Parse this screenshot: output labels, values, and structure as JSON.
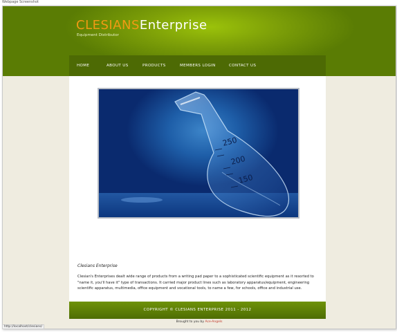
{
  "window": {
    "title": "Webpage Screenshot"
  },
  "brand": {
    "part1": "CLESIANS",
    "part2": "Enterprise",
    "tagline": "Equipment Distributor"
  },
  "nav": {
    "items": [
      "HOME",
      "ABOUT US",
      "PRODUCTS",
      "MEMBERS LOGIN",
      "CONTACT US"
    ]
  },
  "hero": {
    "marks": [
      "250",
      "200",
      "150"
    ]
  },
  "content": {
    "title": "Clesians Enterprise",
    "body": "Clesian's Enterprises dealt wide range of products from a writing pad paper to a sophisticated scientific equipment as it resorted to \"name it, you'll have it\" type of transactions. It carried major product lines such as laboratory apparatus/equipment, engineering scientific apparatus, multimedia, office equipment and vocational tools, to name a few, for schools, office and industrial use."
  },
  "footer": {
    "copyright": "COPYRIGHT © CLESIANS ENTERPRISE 2011 - 2012"
  },
  "credit": {
    "prefix": "Brought to you by ",
    "link": "Ace-Angels"
  },
  "status": {
    "url": "http://localhost/clesians/"
  },
  "colors": {
    "header_green": "#7ea008",
    "nav_dark": "#4d6a04",
    "brand_orange": "#f09a14",
    "page_bg": "#efece0"
  }
}
